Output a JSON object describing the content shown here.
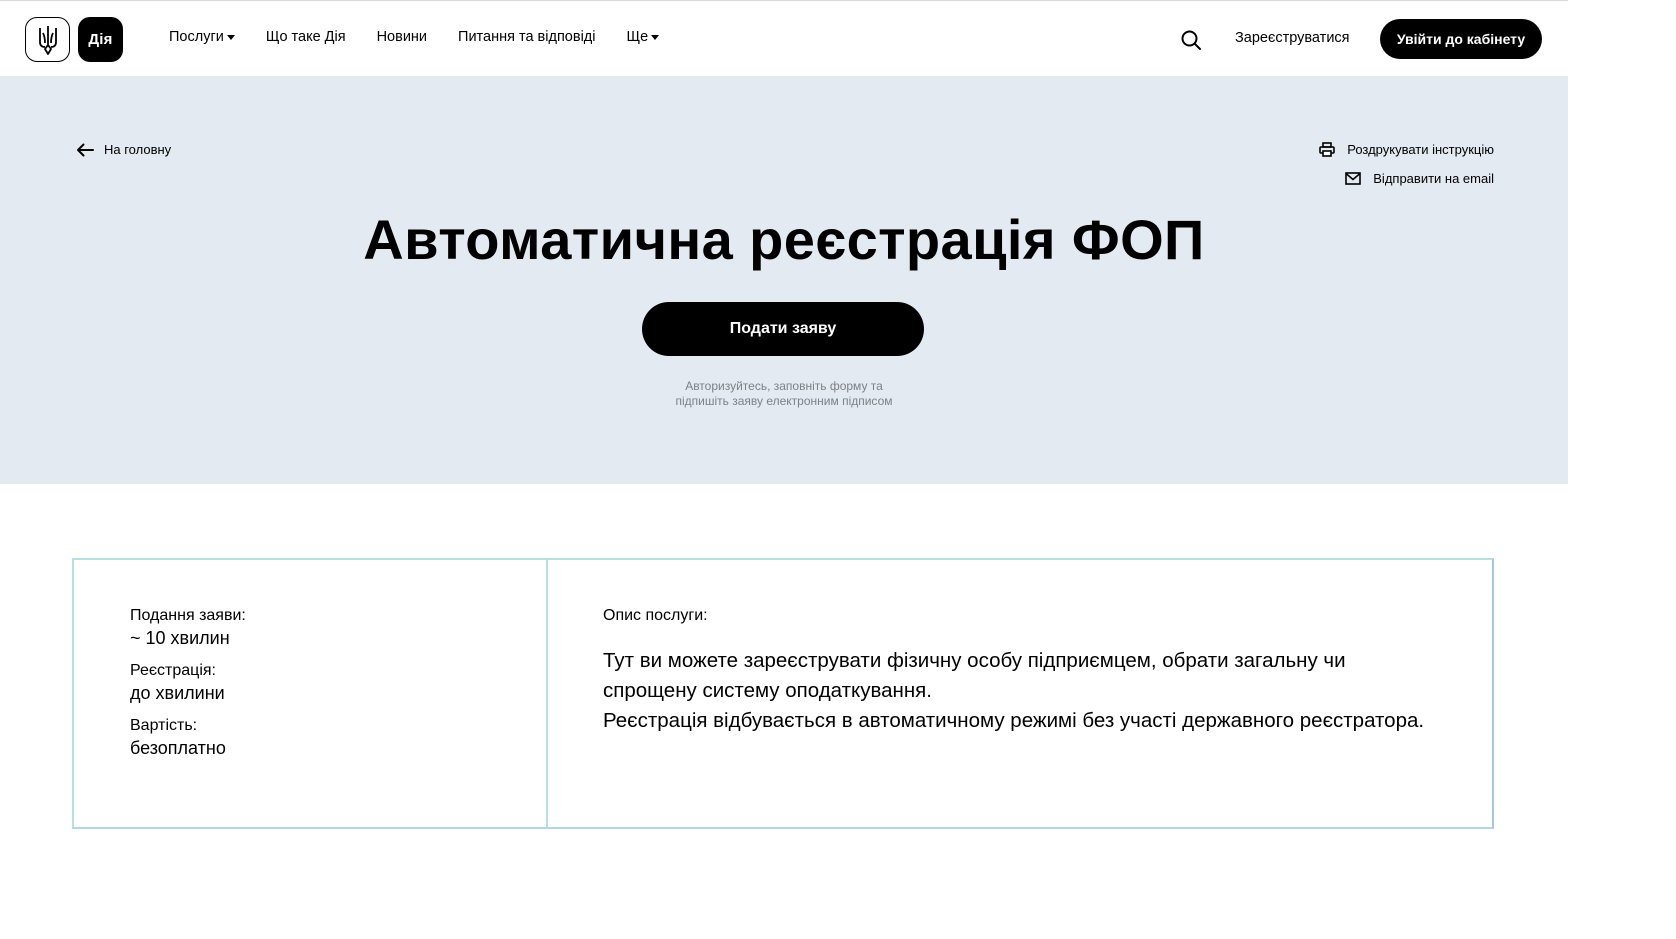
{
  "header": {
    "logo_text": "Дія",
    "nav": [
      {
        "label": "Послуги",
        "has_caret": true
      },
      {
        "label": "Що таке Дія",
        "has_caret": false
      },
      {
        "label": "Новини",
        "has_caret": false
      },
      {
        "label": "Питання та відповіді",
        "has_caret": false
      },
      {
        "label": "Ще",
        "has_caret": true
      }
    ],
    "search_icon": "search-icon",
    "register_label": "Зареєструватися",
    "login_label": "Увійти до кабінету"
  },
  "hero": {
    "back_label": "На головну",
    "print_label": "Роздрукувати інструкцію",
    "email_label": "Відправити на email",
    "title": "Автоматична реєстрація ФОП",
    "apply_label": "Подати заяву",
    "note_line1": "Авторизуйтесь, заповніть форму та",
    "note_line2": "підпишіть заяву електронним підписом"
  },
  "info": {
    "facts": [
      {
        "label": "Подання заяви:",
        "value": "~ 10 хвилин"
      },
      {
        "label": "Реєстрація:",
        "value": "до хвилини"
      },
      {
        "label": "Вартість:",
        "value": "безоплатно"
      }
    ],
    "description_label": "Опис послуги:",
    "description_p1": "Тут ви можете зареєструвати фізичну особу підприємцем, обрати загальну чи спрощену систему оподаткування.",
    "description_p2": "Реєстрація відбувається в автоматичному режимі без участі державного реєстратора."
  },
  "colors": {
    "hero_bg": "#e3eaf1",
    "primary": "#000000",
    "card_border": "#b9e0de",
    "muted_text": "#7d8087"
  }
}
